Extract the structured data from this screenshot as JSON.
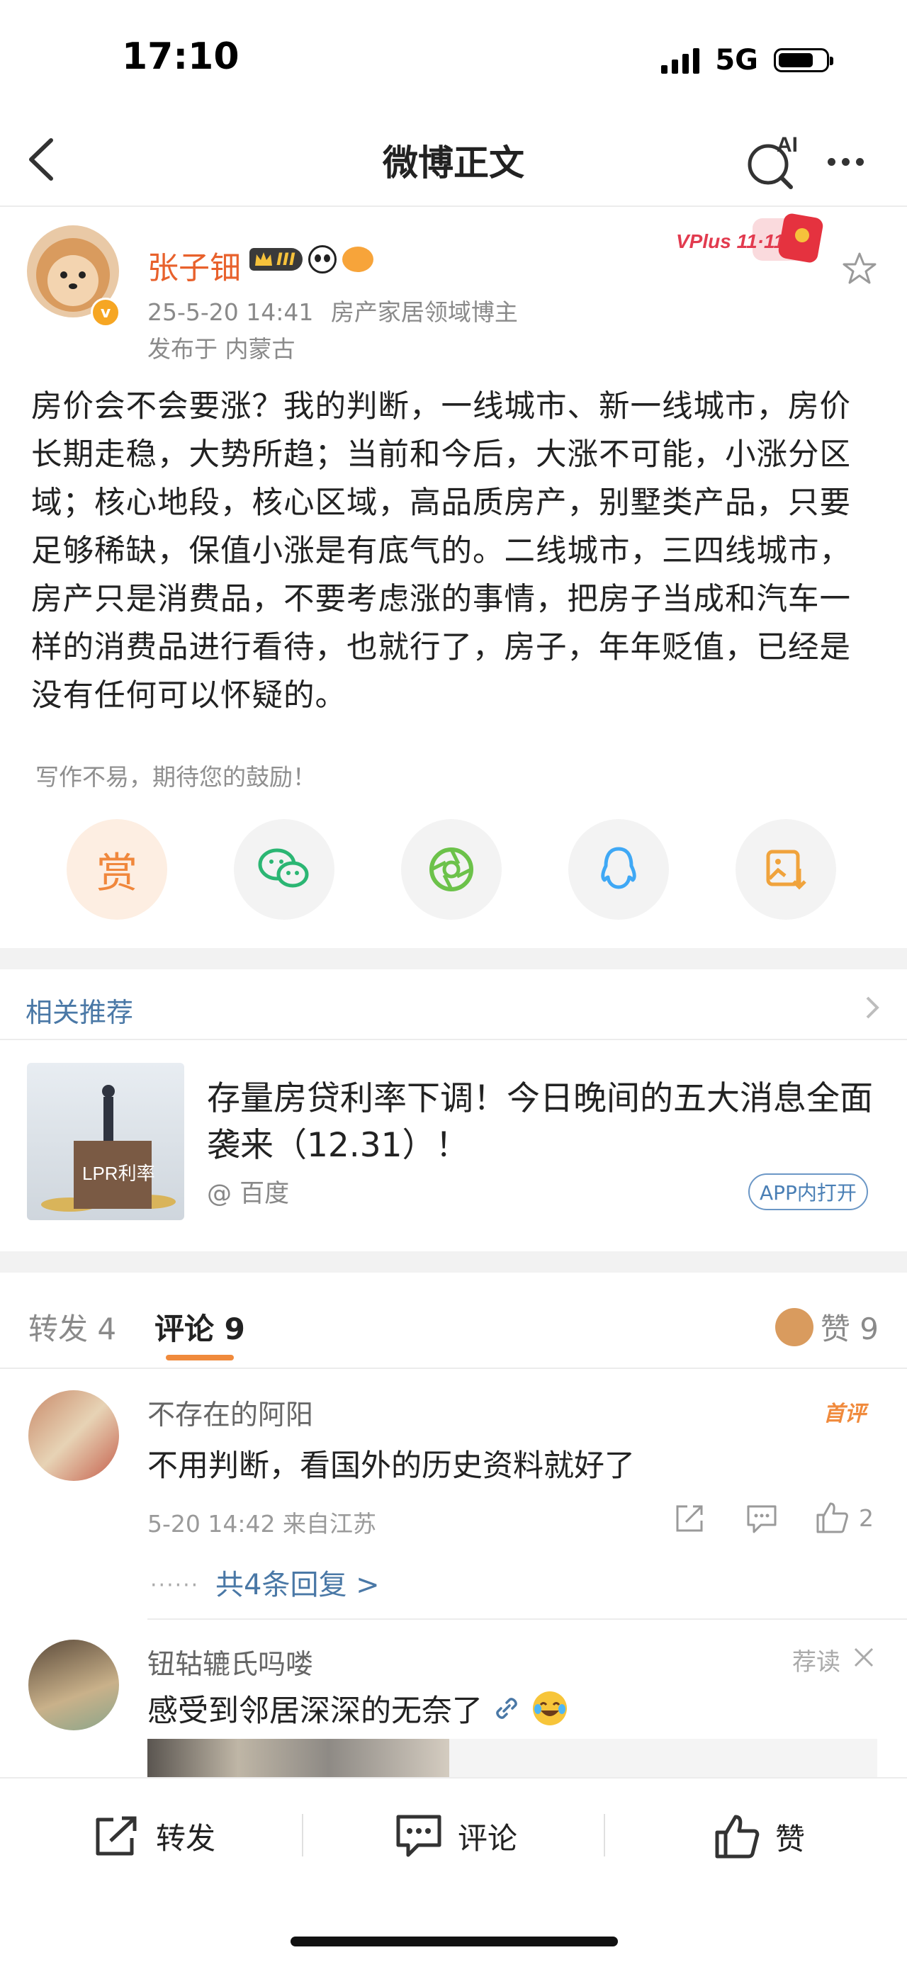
{
  "status_bar": {
    "time": "17:10",
    "network": "5G"
  },
  "nav": {
    "title": "微博正文",
    "ai_label": "AI"
  },
  "post": {
    "author": "张子钿",
    "level_badge": "III",
    "vplus_badge": "VPlus 11·11",
    "timestamp": "25-5-20 14:41",
    "tag": "房产家居领域博主",
    "location": "发布于 内蒙古",
    "body": "房价会不会要涨？我的判断，一线城市、新一线城市，房价长期走稳，大势所趋；当前和今后，大涨不可能，小涨分区域；核心地段，核心区域，高品质房产，别墅类产品，只要足够稀缺，保值小涨是有底气的。二线城市，三四线城市，房产只是消费品，不要考虑涨的事情，把房子当成和汽车一样的消费品进行看待，也就行了，房子，年年贬值，已经是没有任何可以怀疑的。",
    "encourage": "写作不易，期待您的鼓励！",
    "reward_label": "赏"
  },
  "recommend": {
    "title": "相关推荐",
    "card_title": "存量房贷利率下调！今日晚间的五大消息全面袭来（12.31）！",
    "source": "@ 百度",
    "app_badge": "APP内打开",
    "image_text": "LPR利率"
  },
  "tabs": {
    "repost": "转发 4",
    "comment": "评论 9",
    "likes": "赞 9"
  },
  "comments": [
    {
      "name": "不存在的阿阳",
      "badge": "首评",
      "text": "不用判断，看国外的历史资料就好了",
      "meta": "5-20 14:42  来自江苏",
      "likes": "2",
      "replies": "共4条回复 >"
    },
    {
      "name": "钮轱辘氏吗喽",
      "badge": "荐读",
      "text": "感受到邻居深深的无奈了"
    }
  ],
  "bottom_bar": {
    "repost": "转发",
    "comment": "评论",
    "like": "赞"
  },
  "colors": {
    "accent_orange": "#e8612c",
    "link_blue": "#4a78a6",
    "underline": "#f08a3c"
  }
}
